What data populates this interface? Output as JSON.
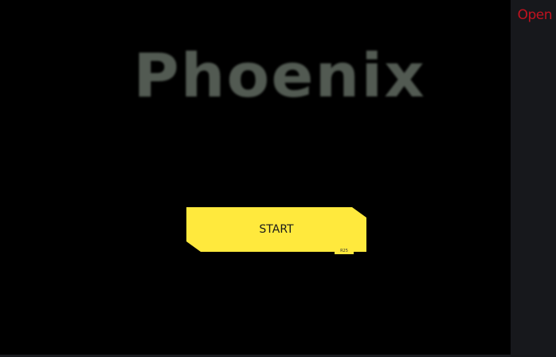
{
  "game": {
    "title": "Phoenix",
    "start_label": "START",
    "version": "R25"
  },
  "side_panel": {
    "open_label": "Open"
  },
  "colors": {
    "background": "#000000",
    "title": "#525a52",
    "button": "#ffe93d",
    "open_link": "#c1121f",
    "side_panel": "#17181c"
  }
}
